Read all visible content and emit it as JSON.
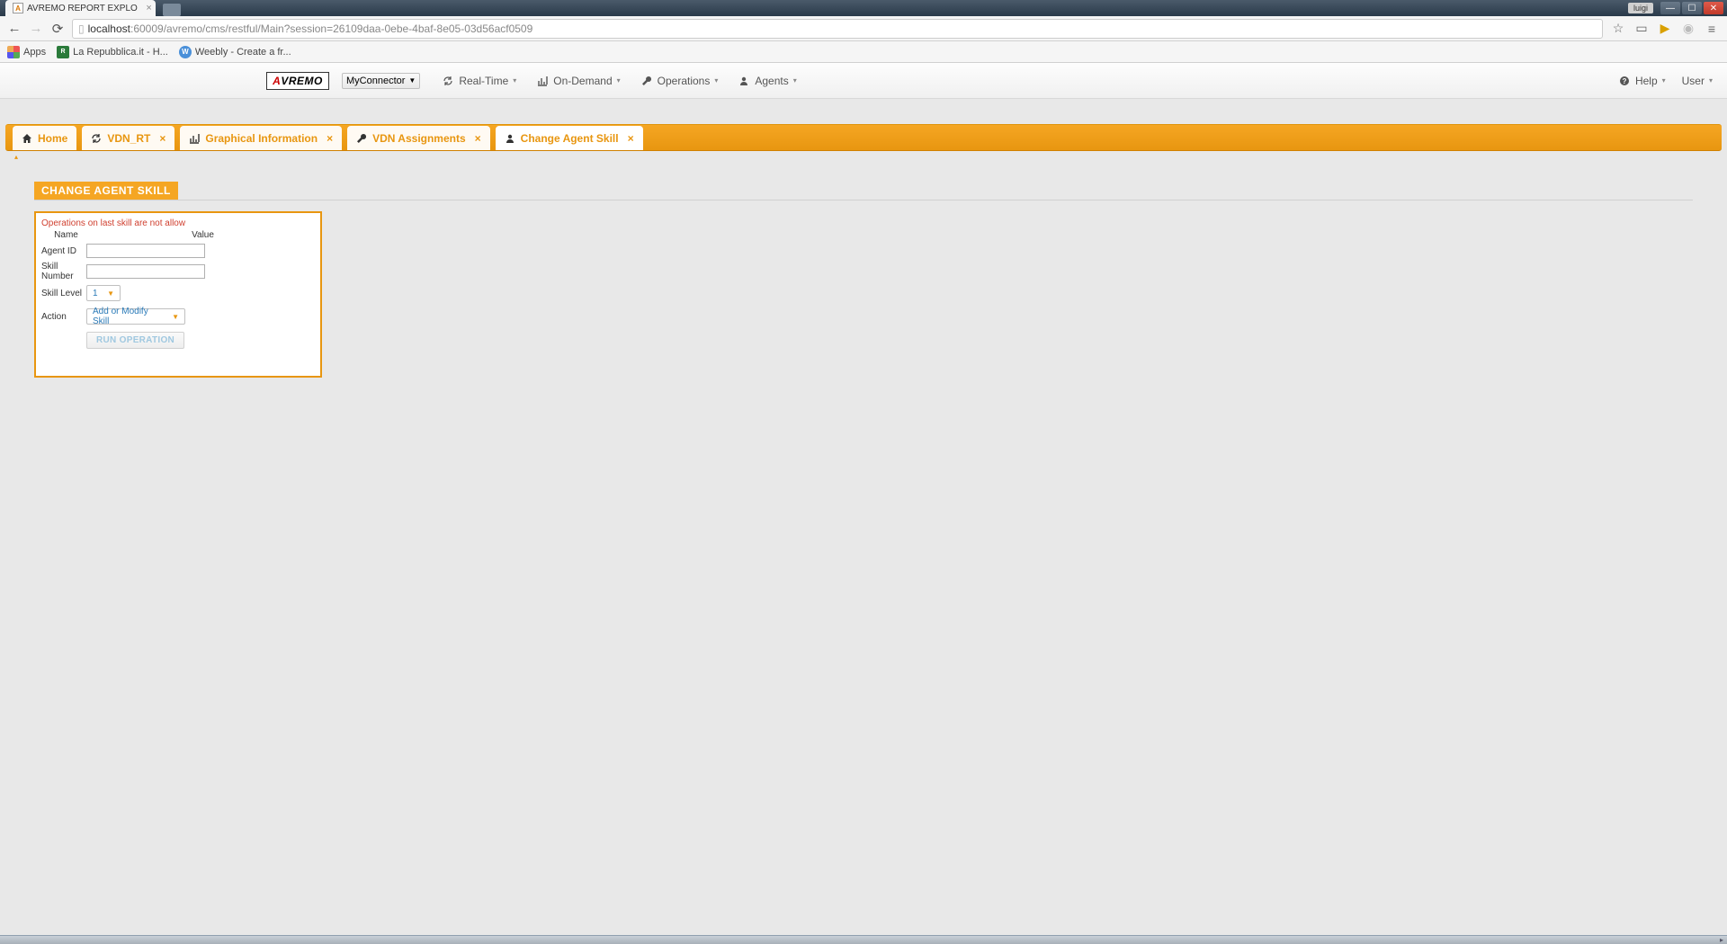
{
  "browser": {
    "tab_title": "AVREMO REPORT EXPLO",
    "url_host": "localhost",
    "url_rest": ":60009/avremo/cms/restful/Main?session=26109daa-0ebe-4baf-8e05-03d56acf0509",
    "user_badge": "luigi",
    "bookmarks": {
      "apps": "Apps",
      "repubblica": "La Repubblica.it - H...",
      "weebly": "Weebly - Create a fr..."
    }
  },
  "app": {
    "logo_a": "A",
    "logo_rest": "VREMO",
    "connector": "MyConnector",
    "menus": {
      "realtime": "Real-Time",
      "ondemand": "On-Demand",
      "operations": "Operations",
      "agents": "Agents",
      "help": "Help",
      "user": "User"
    }
  },
  "tabs": [
    {
      "label": "Home",
      "icon": "home",
      "closable": false
    },
    {
      "label": "VDN_RT",
      "icon": "refresh",
      "closable": true
    },
    {
      "label": "Graphical Information",
      "icon": "chart",
      "closable": true
    },
    {
      "label": "VDN Assignments",
      "icon": "wrench",
      "closable": true
    },
    {
      "label": "Change Agent Skill",
      "icon": "user",
      "closable": true
    }
  ],
  "panel": {
    "title": "CHANGE AGENT SKILL",
    "warning": "Operations on last skill are not allow",
    "headers": {
      "name": "Name",
      "value": "Value"
    },
    "fields": {
      "agent_id_label": "Agent ID",
      "agent_id_value": "",
      "skill_number_label": "Skill Number",
      "skill_number_value": "",
      "skill_level_label": "Skill Level",
      "skill_level_value": "1",
      "action_label": "Action",
      "action_value": "Add or Modify Skill"
    },
    "run_button": "RUN OPERATION"
  }
}
